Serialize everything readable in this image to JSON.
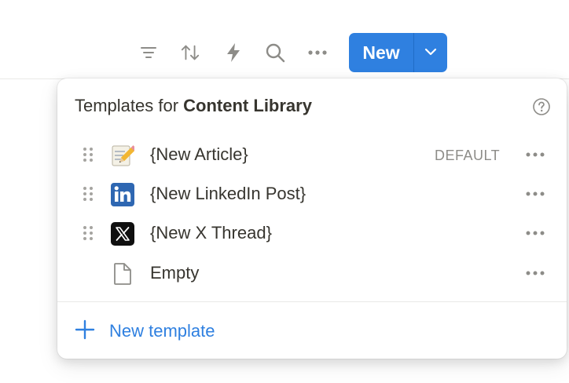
{
  "toolbar": {
    "icons": [
      "filter-icon",
      "sort-icon",
      "automation-bolt-icon",
      "search-icon",
      "more-icon"
    ],
    "new_button_label": "New",
    "accent_color": "#2f80e0"
  },
  "popup": {
    "title_prefix": "Templates for ",
    "title_bold": "Content Library",
    "templates": [
      {
        "label": "{New Article}",
        "icon": "memo-pencil-icon",
        "badge": "DEFAULT"
      },
      {
        "label": "{New LinkedIn Post}",
        "icon": "linkedin-icon",
        "badge": ""
      },
      {
        "label": "{New X Thread}",
        "icon": "x-icon",
        "badge": ""
      },
      {
        "label": "Empty",
        "icon": "page-icon",
        "badge": ""
      }
    ],
    "new_template_label": "New template"
  }
}
